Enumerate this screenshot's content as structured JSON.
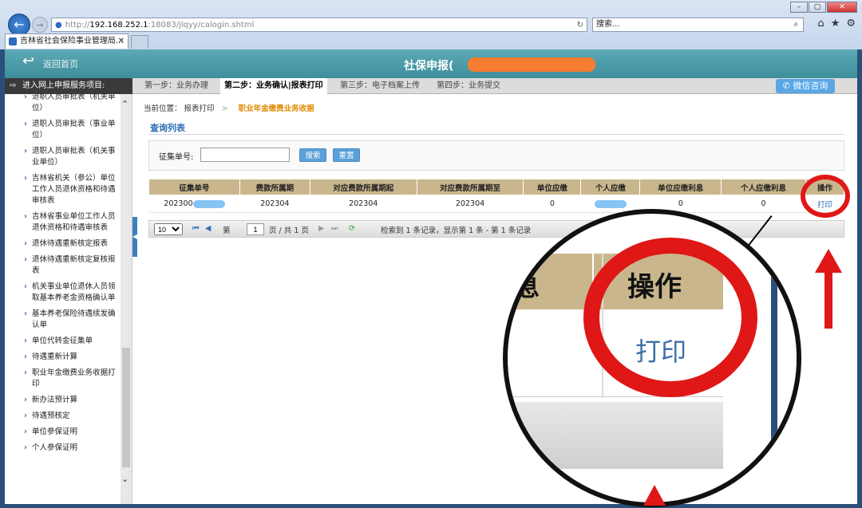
{
  "browser": {
    "url_prefix": "http://",
    "url_host": "192.168.252.1",
    "url_rest": ":18083/jlqyy/calogin.shtml",
    "search_placeholder": "搜索...",
    "tab_title": "吉林省社会保险事业管理局...",
    "window_buttons": [
      "–",
      "▢",
      "✕"
    ]
  },
  "header": {
    "back_label": "返回首页",
    "title": "社保申报("
  },
  "steps": {
    "side_header": "进入网上申报服务项目:",
    "items": [
      "第一步：业务办理",
      "第二步：业务确认|报表打印",
      "第三步：电子档案上传",
      "第四步：业务提交"
    ],
    "wechat_label": "微信咨询"
  },
  "sidebar": {
    "items": [
      "退职人员审批表（机关单位）",
      "退职人员审批表（事业单位）",
      "退职人员审批表（机关事业单位）",
      "吉林省机关（参公）单位工作人员退休资格和待遇审核表",
      "吉林省事业单位工作人员退休资格和待遇审核表",
      "退休待遇重新核定报表",
      "退休待遇重新核定复核报表",
      "机关事业单位退休人员领取基本养老金资格确认单",
      "基本养老保险待遇续发确认单",
      "单位代转金征集单",
      "待遇重新计算",
      "职业年金缴费业务收据打印",
      "新办法预计算",
      "待遇预核定",
      "单位参保证明",
      "个人参保证明"
    ]
  },
  "breadcrumb": {
    "prefix": "当前位置：",
    "level1": "报表打印",
    "sep": ">",
    "current": "职业年金缴费业务收据"
  },
  "query": {
    "section_title": "查询列表",
    "field_label": "征集单号:",
    "field_value": "",
    "search_button": "搜索",
    "reset_button": "重置"
  },
  "table": {
    "headers": [
      "征集单号",
      "费款所属期",
      "对应费款所属期起",
      "对应费款所属期至",
      "单位应缴",
      "个人应缴",
      "单位应缴利息",
      "个人应缴利息",
      "操作"
    ],
    "rows": [
      {
        "id": "202300",
        "period": "202304",
        "from": "202304",
        "to": "202304",
        "unit_due": "0",
        "person_due": "",
        "unit_interest": "0",
        "person_interest": "0",
        "action": "打印"
      }
    ]
  },
  "pager": {
    "page_size": "10",
    "page_label": "第",
    "page_value": "1",
    "of_label": "页 / 共 1 页",
    "summary": "检索到 1 条记录，显示第 1 条 - 第 1 条记录"
  },
  "magnifier": {
    "partial_header": "息",
    "header": "操作",
    "action": "打印"
  },
  "colors": {
    "header_teal": "#4a9ca8",
    "table_header": "#c9b68c",
    "annotation_red": "#e01717",
    "accent_blue": "#2a6cb3"
  }
}
